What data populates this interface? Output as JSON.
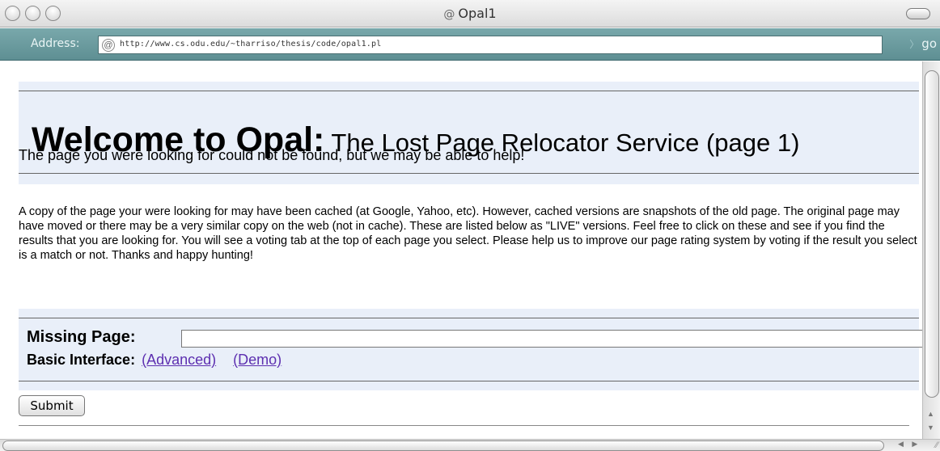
{
  "window": {
    "title": "Opal1",
    "title_icon": "@"
  },
  "address_bar": {
    "label": "Address:",
    "site_icon": "@",
    "url": "http://www.cs.odu.edu/~tharriso/thesis/code/opal1.pl",
    "go_label": "go",
    "go_arrow": "〉"
  },
  "page": {
    "heading_bold": "Welcome to Opal:",
    "heading_rest": " The Lost Page Relocator Service (page 1)",
    "tagline": "The page you were looking for could not be found, but we may be able to help!",
    "paragraph": "A copy of the page your were looking for may have been cached (at Google, Yahoo, etc). However, cached versions are snapshots of the old page. The original page may have moved or there may be a very similar copy on the web (not in cache). These are listed below as \"LIVE\" versions. Feel free to click on these and see if you find the results that you are looking for. You will see a voting tab at the top of each page you select. Please help us to improve our page rating system by voting if the result you select is a match or not. Thanks and happy hunting!",
    "form": {
      "missing_label": "Missing Page:",
      "missing_value": "",
      "interface_label": "Basic Interface:",
      "advanced_link": "(Advanced)",
      "demo_link": "(Demo)",
      "submit_label": "Submit"
    }
  },
  "scrollbars": {
    "up_arrow": "▲",
    "down_arrow": "▼",
    "h_arrows": "◀ ▶",
    "grip": "⁄⁄"
  }
}
